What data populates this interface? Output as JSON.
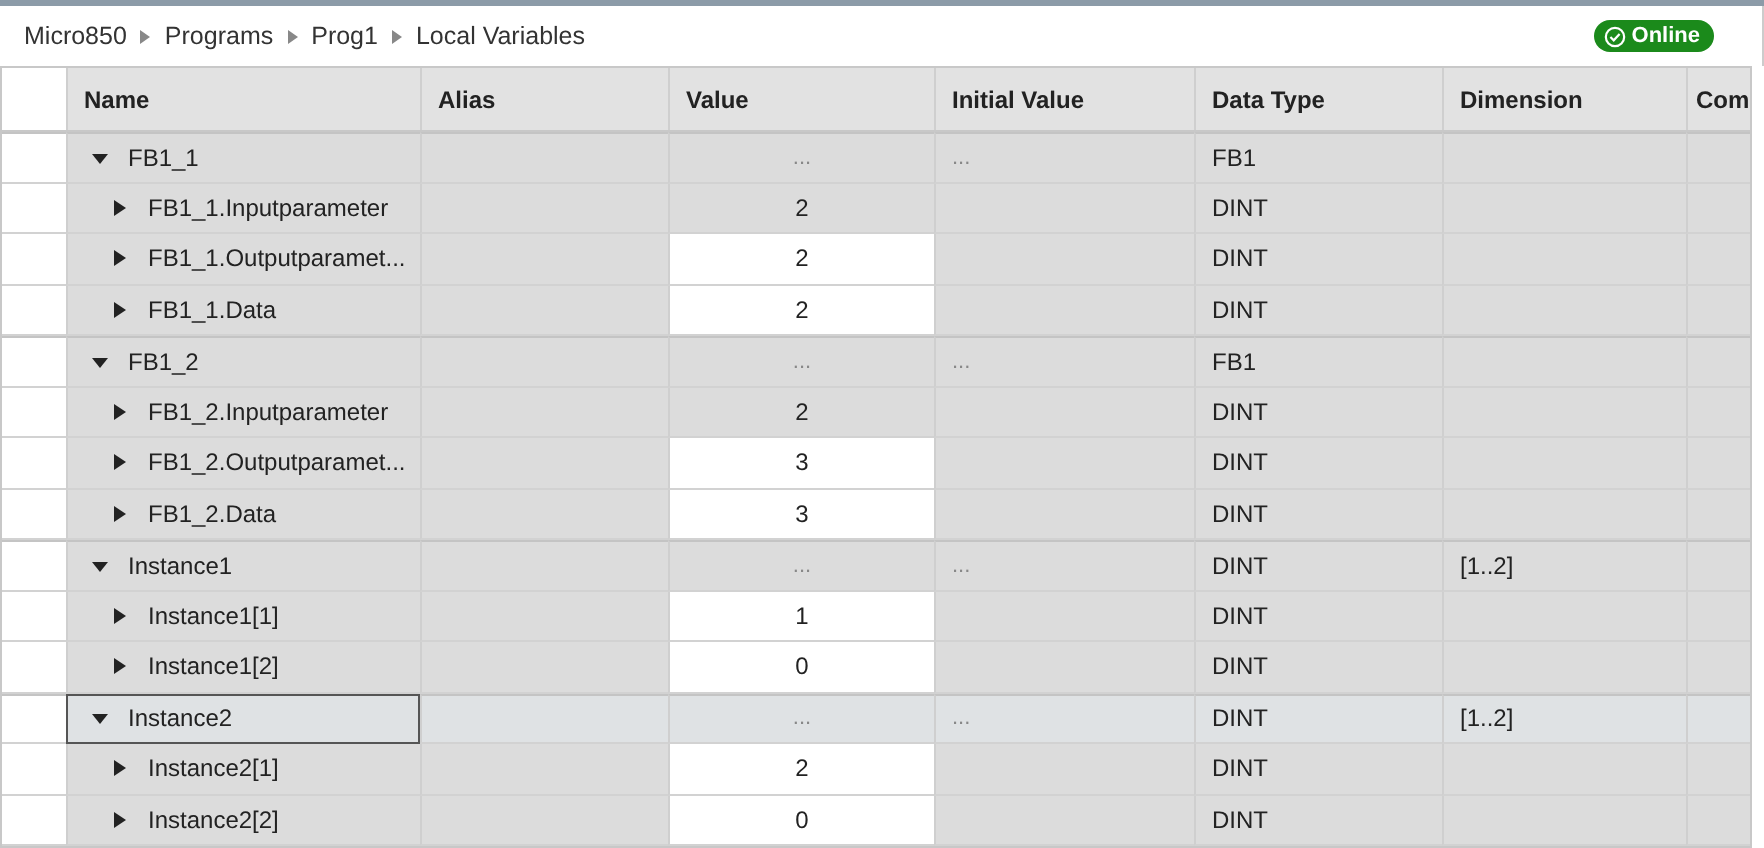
{
  "breadcrumb": [
    "Micro850",
    "Programs",
    "Prog1",
    "Local Variables"
  ],
  "status": {
    "label": "Online",
    "online": true
  },
  "columns": [
    "Name",
    "Alias",
    "Value",
    "Initial Value",
    "Data Type",
    "Dimension",
    "Com"
  ],
  "rows": [
    {
      "name": "FB1_1",
      "expanded": true,
      "selected": false,
      "value": "...",
      "editable": false,
      "initial_value": "...",
      "data_type": "FB1",
      "dimension": "",
      "children": [
        {
          "name": "FB1_1.Inputparameter",
          "expanded": false,
          "selected": false,
          "value": "2",
          "editable": false,
          "data_type": "DINT"
        },
        {
          "name": "FB1_1.Outputparamet...",
          "expanded": false,
          "selected": false,
          "value": "2",
          "editable": true,
          "data_type": "DINT"
        },
        {
          "name": "FB1_1.Data",
          "expanded": false,
          "selected": false,
          "value": "2",
          "editable": true,
          "data_type": "DINT"
        }
      ]
    },
    {
      "name": "FB1_2",
      "expanded": true,
      "selected": false,
      "value": "...",
      "editable": false,
      "initial_value": "...",
      "data_type": "FB1",
      "dimension": "",
      "children": [
        {
          "name": "FB1_2.Inputparameter",
          "expanded": false,
          "selected": false,
          "value": "2",
          "editable": false,
          "data_type": "DINT"
        },
        {
          "name": "FB1_2.Outputparamet...",
          "expanded": false,
          "selected": false,
          "value": "3",
          "editable": true,
          "data_type": "DINT"
        },
        {
          "name": "FB1_2.Data",
          "expanded": false,
          "selected": false,
          "value": "3",
          "editable": true,
          "data_type": "DINT"
        }
      ]
    },
    {
      "name": "Instance1",
      "expanded": true,
      "selected": false,
      "value": "...",
      "editable": false,
      "initial_value": "...",
      "data_type": "DINT",
      "dimension": "[1..2]",
      "children": [
        {
          "name": "Instance1[1]",
          "expanded": false,
          "selected": false,
          "value": "1",
          "editable": true,
          "data_type": "DINT"
        },
        {
          "name": "Instance1[2]",
          "expanded": false,
          "selected": false,
          "value": "0",
          "editable": true,
          "data_type": "DINT"
        }
      ]
    },
    {
      "name": "Instance2",
      "expanded": true,
      "selected": true,
      "value": "...",
      "editable": false,
      "initial_value": "...",
      "data_type": "DINT",
      "dimension": "[1..2]",
      "children": [
        {
          "name": "Instance2[1]",
          "expanded": false,
          "selected": false,
          "value": "2",
          "editable": true,
          "data_type": "DINT"
        },
        {
          "name": "Instance2[2]",
          "expanded": false,
          "selected": false,
          "value": "0",
          "editable": true,
          "data_type": "DINT"
        }
      ]
    }
  ]
}
